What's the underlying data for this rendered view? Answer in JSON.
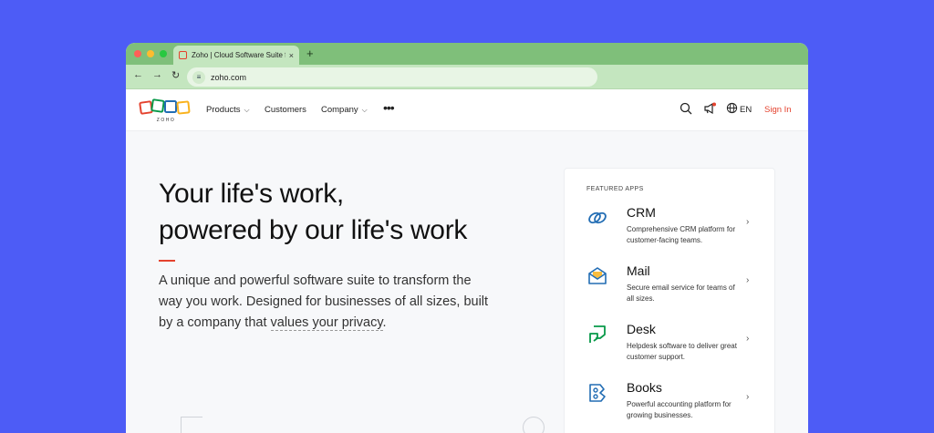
{
  "browser": {
    "tab_title": "Zoho | Cloud Software Suite f",
    "tab_close": "×",
    "new_tab": "+",
    "url": "zoho.com",
    "back": "←",
    "forward": "→",
    "reload": "↻"
  },
  "header": {
    "logo_text": "ZOHO",
    "nav": [
      "Products",
      "Customers",
      "Company"
    ],
    "more": "•••",
    "lang": "EN",
    "signin": "Sign In"
  },
  "hero": {
    "title_line1": "Your life's work,",
    "title_line2": "powered by our life's work",
    "desc_prefix": "A unique and powerful software suite to transform the way you work. Designed for businesses of all sizes, built by a company that ",
    "desc_link": "values your privacy",
    "desc_suffix": "."
  },
  "featured": {
    "label": "FEATURED APPS",
    "apps": [
      {
        "name": "CRM",
        "desc": "Comprehensive CRM platform for customer-facing teams.",
        "icon": "crm-icon"
      },
      {
        "name": "Mail",
        "desc": "Secure email service for teams of all sizes.",
        "icon": "mail-icon"
      },
      {
        "name": "Desk",
        "desc": "Helpdesk software to deliver great customer support.",
        "icon": "desk-icon"
      },
      {
        "name": "Books",
        "desc": "Powerful accounting platform for growing businesses.",
        "icon": "books-icon"
      }
    ]
  },
  "colors": {
    "background": "#4d5cf6",
    "accent_red": "#e4422e",
    "browser_green": "#7fbf7a"
  }
}
